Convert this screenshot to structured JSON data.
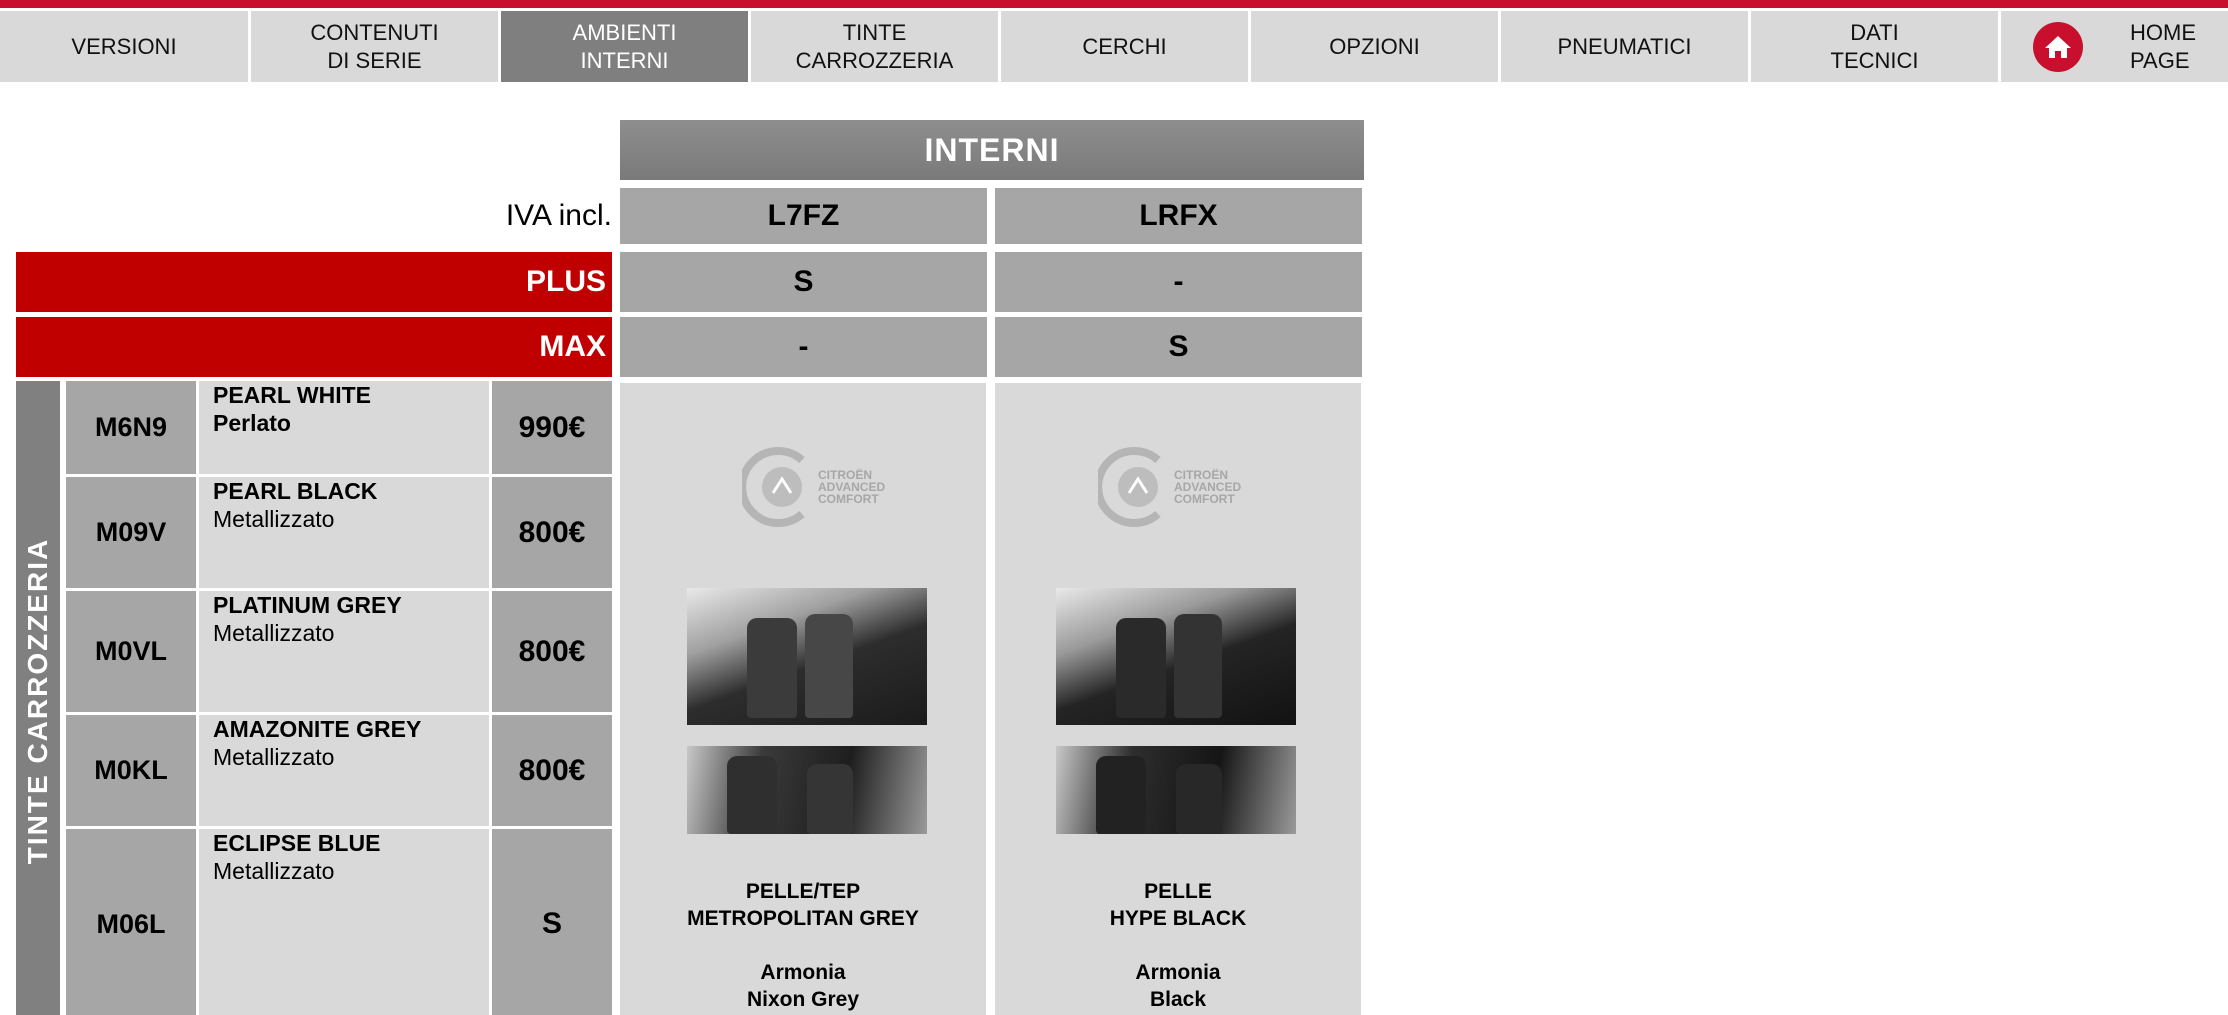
{
  "nav": {
    "versioni": "VERSIONI",
    "contenuti": "CONTENUTI\nDI SERIE",
    "ambienti": "AMBIENTI\nINTERNI",
    "tinte": "TINTE\nCARROZZERIA",
    "cerchi": "CERCHI",
    "opzioni": "OPZIONI",
    "pneumatici": "PNEUMATICI",
    "dati": "DATI\nTECNICI",
    "home": "HOME\nPAGE",
    "home_icon": "house-icon"
  },
  "table": {
    "title": "INTERNI",
    "iva": "IVA incl.",
    "columns": [
      "L7FZ",
      "LRFX"
    ],
    "trims": [
      {
        "label": "PLUS",
        "values": [
          "S",
          "-"
        ]
      },
      {
        "label": "MAX",
        "values": [
          "-",
          "S"
        ]
      }
    ],
    "section_label": "TINTE CARROZZERIA",
    "paints": [
      {
        "code": "M6N9",
        "name": "PEARL WHITE",
        "finish": "Perlato",
        "price": "990€"
      },
      {
        "code": "M09V",
        "name": "PEARL BLACK",
        "finish": "Metallizzato",
        "price": "800€"
      },
      {
        "code": "M0VL",
        "name": "PLATINUM GREY",
        "finish": "Metallizzato",
        "price": "800€"
      },
      {
        "code": "M0KL",
        "name": "AMAZONITE GREY",
        "finish": "Metallizzato",
        "price": "800€"
      },
      {
        "code": "M06L",
        "name": "ECLIPSE BLUE",
        "finish": "Metallizzato",
        "price": "S"
      }
    ]
  },
  "interiors": [
    {
      "logo_line1": "CITROËN",
      "logo_line2": "ADVANCED",
      "logo_line3": "COMFORT",
      "material_line1": "PELLE/TEP",
      "material_line2": "METROPOLITAN GREY",
      "ambience_line1": "Armonia",
      "ambience_line2": "Nixon Grey"
    },
    {
      "logo_line1": "CITROËN",
      "logo_line2": "ADVANCED",
      "logo_line3": "COMFORT",
      "material_line1": "PELLE",
      "material_line2": "HYPE BLACK",
      "ambience_line1": "Armonia",
      "ambience_line2": "Black"
    }
  ],
  "colors": {
    "brand_red": "#c8102e",
    "trim_red": "#c00000",
    "dark_grey": "#a6a6a6",
    "light_grey": "#d9d9d9"
  }
}
